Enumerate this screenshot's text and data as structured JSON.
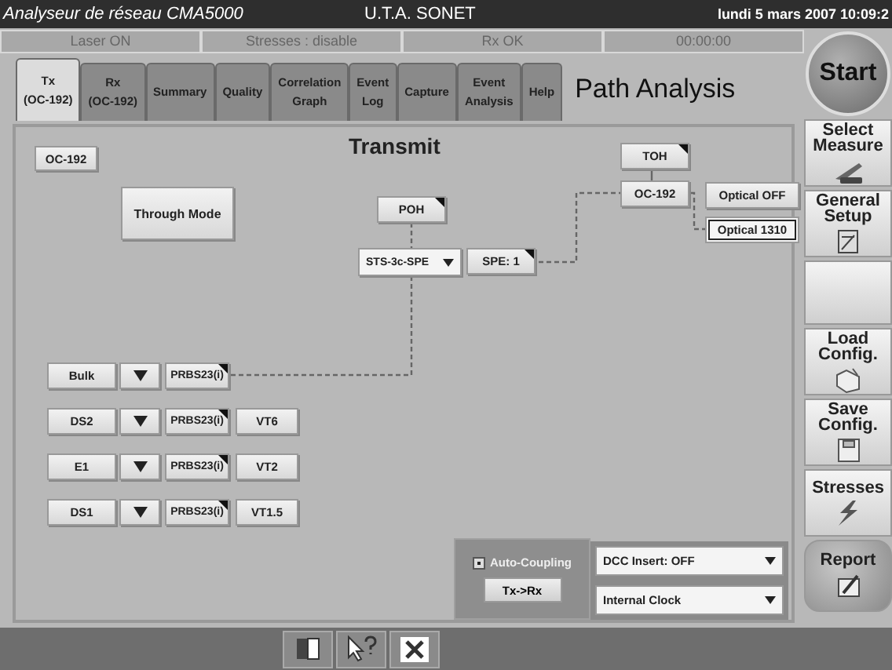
{
  "title_bar": {
    "app_title": "Analyseur de réseau CMA5000",
    "center_title": "U.T.A. SONET",
    "datetime": "lundi 5 mars 2007 10:09:2"
  },
  "status_strip": [
    "Laser ON",
    "Stresses : disable",
    "Rx OK",
    "00:00:00"
  ],
  "tabs": [
    {
      "label": "Tx\n(OC-192)",
      "selected": true
    },
    {
      "label": "Rx\n(OC-192)",
      "selected": false
    },
    {
      "label": "Summary",
      "selected": false
    },
    {
      "label": "Quality",
      "selected": false
    },
    {
      "label": "Correlation\nGraph",
      "selected": false
    },
    {
      "label": "Event\nLog",
      "selected": false
    },
    {
      "label": "Capture",
      "selected": false
    },
    {
      "label": "Event\nAnalysis",
      "selected": false
    },
    {
      "label": "Help",
      "selected": false
    }
  ],
  "page_title": "Path Analysis",
  "start_button": "Start",
  "side_buttons": [
    {
      "kind": "measure",
      "label": "Select\nMeasure"
    },
    {
      "kind": "setup",
      "label": "General\nSetup"
    },
    {
      "kind": "blank"
    },
    {
      "kind": "load",
      "label": "Load\nConfig."
    },
    {
      "kind": "save",
      "label": "Save\nConfig."
    },
    {
      "kind": "stresses",
      "label": "Stresses"
    },
    {
      "kind": "report",
      "label": "Report"
    }
  ],
  "diagram": {
    "title": "Transmit",
    "line_rate": "OC-192",
    "through_mode": "Through Mode",
    "poh": "POH",
    "mapping": "STS-3c-SPE",
    "spe": "SPE: 1",
    "toh": "TOH",
    "port": "OC-192",
    "optical_options": [
      {
        "label": "Optical OFF",
        "selected": false
      },
      {
        "label": "Optical 1310",
        "selected": true
      }
    ],
    "tributaries": [
      {
        "label": "Bulk",
        "pattern": "PRBS23(i)"
      },
      {
        "label": "DS2",
        "pattern": "PRBS23(i)",
        "container": "VT6"
      },
      {
        "label": "E1",
        "pattern": "PRBS23(i)",
        "container": "VT2"
      },
      {
        "label": "DS1",
        "pattern": "PRBS23(i)",
        "container": "VT1.5"
      }
    ]
  },
  "coupling": {
    "label": "Auto-Coupling",
    "checked": true,
    "button": "Tx->Rx"
  },
  "dropdowns": [
    "DCC Insert: OFF",
    "Internal Clock"
  ]
}
